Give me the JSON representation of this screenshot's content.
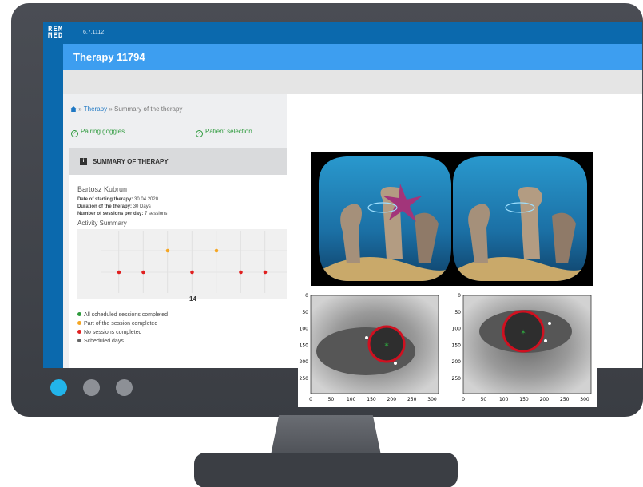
{
  "app": {
    "logo_line1": "REM",
    "logo_line2": "MED",
    "version": "6.7.1112",
    "title": "Therapy 11794"
  },
  "breadcrumb": {
    "separator": "»",
    "therapy": "Therapy",
    "current": "Summary of the therapy"
  },
  "steps": [
    {
      "label": "Pairing goggles"
    },
    {
      "label": "Patient selection"
    }
  ],
  "summary": {
    "icon_letter": "i",
    "title": "SUMMARY OF THERAPY",
    "patient_name": "Bartosz Kubrun",
    "start_label": "Date of starting therapy:",
    "start_value": "30.04.2020",
    "duration_label": "Duration of the therapy:",
    "duration_value": "30 Days",
    "sessions_label": "Number of sessions per day:",
    "sessions_value": "7 sessions",
    "activity_title": "Activity Summary"
  },
  "chart_data": {
    "type": "scatter",
    "x_label_shown": "14",
    "points": [
      {
        "col": 1,
        "row": "lower",
        "status": "none"
      },
      {
        "col": 2,
        "row": "lower",
        "status": "none"
      },
      {
        "col": 3,
        "row": "upper",
        "status": "partial"
      },
      {
        "col": 4,
        "row": "lower",
        "status": "none"
      },
      {
        "col": 5,
        "row": "upper",
        "status": "partial"
      },
      {
        "col": 6,
        "row": "lower",
        "status": "none"
      },
      {
        "col": 7,
        "row": "lower",
        "status": "none"
      }
    ]
  },
  "legend": [
    {
      "label": "All scheduled sessions completed",
      "color": "#2e9a3d"
    },
    {
      "label": "Part of the session completed",
      "color": "#f5a623"
    },
    {
      "label": "No sessions completed",
      "color": "#e02020"
    },
    {
      "label": "Scheduled days",
      "color": "#666666"
    }
  ],
  "colors": {
    "brand_dark": "#0b69ad",
    "brand_light": "#3d9ef0",
    "success": "#2e9a3d",
    "partial": "#f5a623",
    "none": "#e02020",
    "pupil_ring": "#d01020"
  },
  "eye_plot": {
    "left_yticks": [
      "0",
      "50",
      "100",
      "150",
      "200",
      "250"
    ],
    "left_xticks": [
      "0",
      "50",
      "100",
      "150",
      "200",
      "250",
      "300"
    ],
    "right_yticks": [
      "0",
      "50",
      "100",
      "150",
      "200",
      "250"
    ],
    "right_xticks": [
      "0",
      "50",
      "100",
      "150",
      "200",
      "250",
      "300"
    ]
  }
}
